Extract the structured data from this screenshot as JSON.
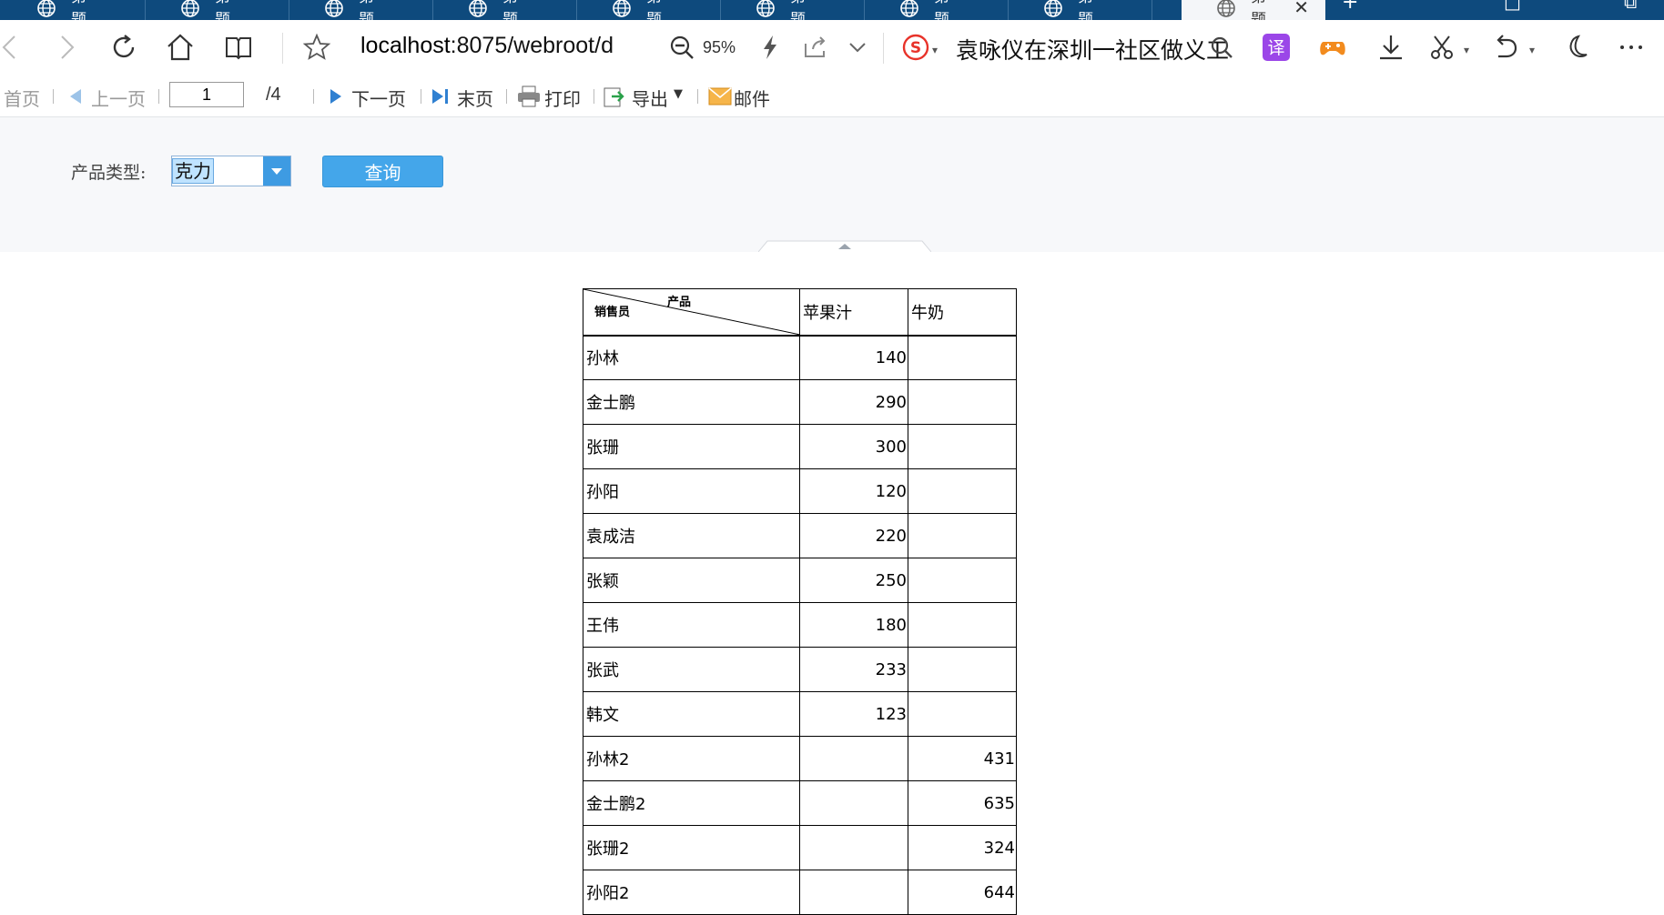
{
  "browser": {
    "tabs": [
      {
        "label": "第 题"
      },
      {
        "label": "第 题"
      },
      {
        "label": "第 题"
      },
      {
        "label": "第 题"
      },
      {
        "label": "第 题"
      },
      {
        "label": "第 题"
      },
      {
        "label": "第 题"
      },
      {
        "label": "第 题"
      },
      {
        "label": "第 题",
        "active": true
      }
    ],
    "url_host": "localhost",
    "url_rest": ":8075/webroot/d",
    "zoom": "95%",
    "search_text": "袁咏仪在深圳一社区做义工",
    "accent": "#0e4a7d"
  },
  "report_toolbar": {
    "first": "首页",
    "prev": "上一页",
    "page_current": "1",
    "page_total": "/4",
    "next": "下一页",
    "last": "末页",
    "print": "打印",
    "export": "导出",
    "email": "邮件"
  },
  "params": {
    "label": "产品类型:",
    "combo_value": "克力",
    "query_label": "查询"
  },
  "report": {
    "corner_top": "产品",
    "corner_bottom": "销售员",
    "columns": [
      "苹果汁",
      "牛奶"
    ],
    "rows": [
      {
        "name": "孙林",
        "apple": "140",
        "milk": ""
      },
      {
        "name": "金士鹏",
        "apple": "290",
        "milk": ""
      },
      {
        "name": "张珊",
        "apple": "300",
        "milk": ""
      },
      {
        "name": "孙阳",
        "apple": "120",
        "milk": ""
      },
      {
        "name": "袁成洁",
        "apple": "220",
        "milk": ""
      },
      {
        "name": "张颖",
        "apple": "250",
        "milk": ""
      },
      {
        "name": "王伟",
        "apple": "180",
        "milk": ""
      },
      {
        "name": "张武",
        "apple": "233",
        "milk": ""
      },
      {
        "name": "韩文",
        "apple": "123",
        "milk": ""
      },
      {
        "name": "孙林2",
        "apple": "",
        "milk": "431"
      },
      {
        "name": "金士鹏2",
        "apple": "",
        "milk": "635"
      },
      {
        "name": "张珊2",
        "apple": "",
        "milk": "324"
      },
      {
        "name": "孙阳2",
        "apple": "",
        "milk": "644"
      }
    ]
  }
}
